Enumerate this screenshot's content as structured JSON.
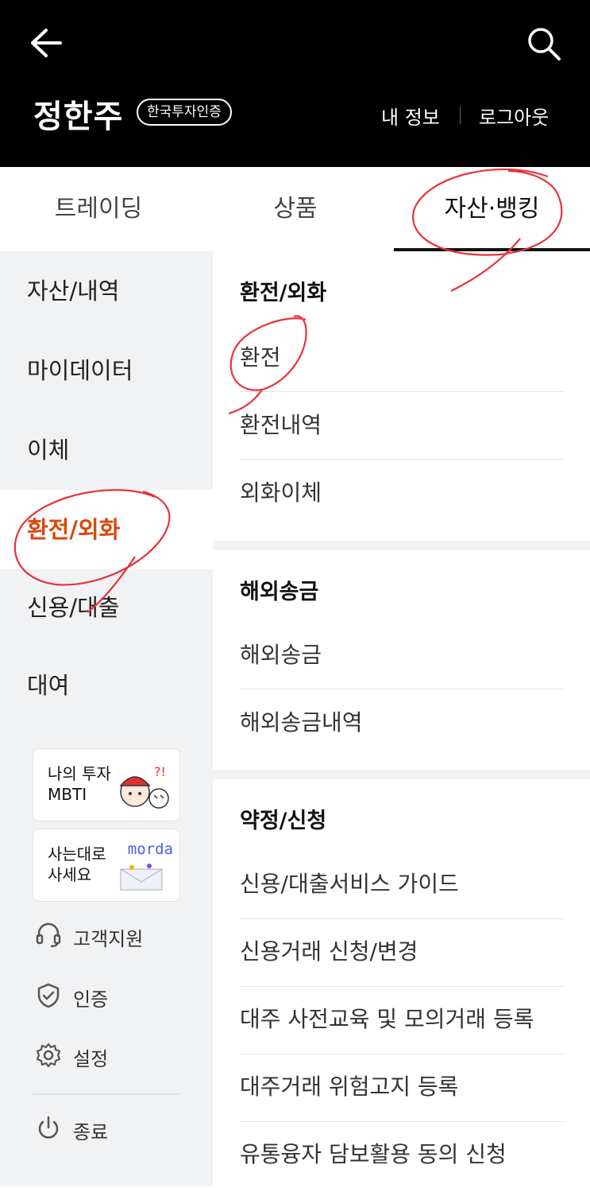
{
  "header": {
    "user_name": "정한주",
    "cert_badge": "한국투자인증",
    "my_info": "내 정보",
    "logout": "로그아웃",
    "icons": {
      "back": "arrow-left-icon",
      "search": "search-icon"
    }
  },
  "tabs": [
    {
      "label": "트레이딩",
      "active": false
    },
    {
      "label": "상품",
      "active": false
    },
    {
      "label": "자산·뱅킹",
      "active": true
    }
  ],
  "sidebar": {
    "items": [
      {
        "label": "자산/내역",
        "active": false
      },
      {
        "label": "마이데이터",
        "active": false
      },
      {
        "label": "이체",
        "active": false
      },
      {
        "label": "환전/외화",
        "active": true
      },
      {
        "label": "신용/대출",
        "active": false
      },
      {
        "label": "대여",
        "active": false
      }
    ],
    "promos": [
      {
        "text": "나의 투자\nMBTI"
      },
      {
        "text": "사는대로\n사세요",
        "brand": "morda"
      }
    ],
    "utilities": [
      {
        "label": "고객지원",
        "icon": "headset-icon"
      },
      {
        "label": "인증",
        "icon": "shield-check-icon"
      },
      {
        "label": "설정",
        "icon": "gear-icon"
      },
      {
        "label": "종료",
        "icon": "power-icon"
      }
    ]
  },
  "content": {
    "sections": [
      {
        "title": "환전/외화",
        "items": [
          "환전",
          "환전내역",
          "외화이체"
        ]
      },
      {
        "title": "해외송금",
        "items": [
          "해외송금",
          "해외송금내역"
        ]
      },
      {
        "title": "약정/신청",
        "items": [
          "신용/대출서비스 가이드",
          "신용거래 신청/변경",
          "대주 사전교육 및 모의거래 등록",
          "대주거래 위험고지 등록",
          "유통융자 담보활용 동의 신청"
        ]
      }
    ]
  },
  "colors": {
    "header_bg": "#000000",
    "active_accent": "#d9480f",
    "sidebar_bg": "#f1f2f4",
    "annotation": "#e8323c"
  }
}
